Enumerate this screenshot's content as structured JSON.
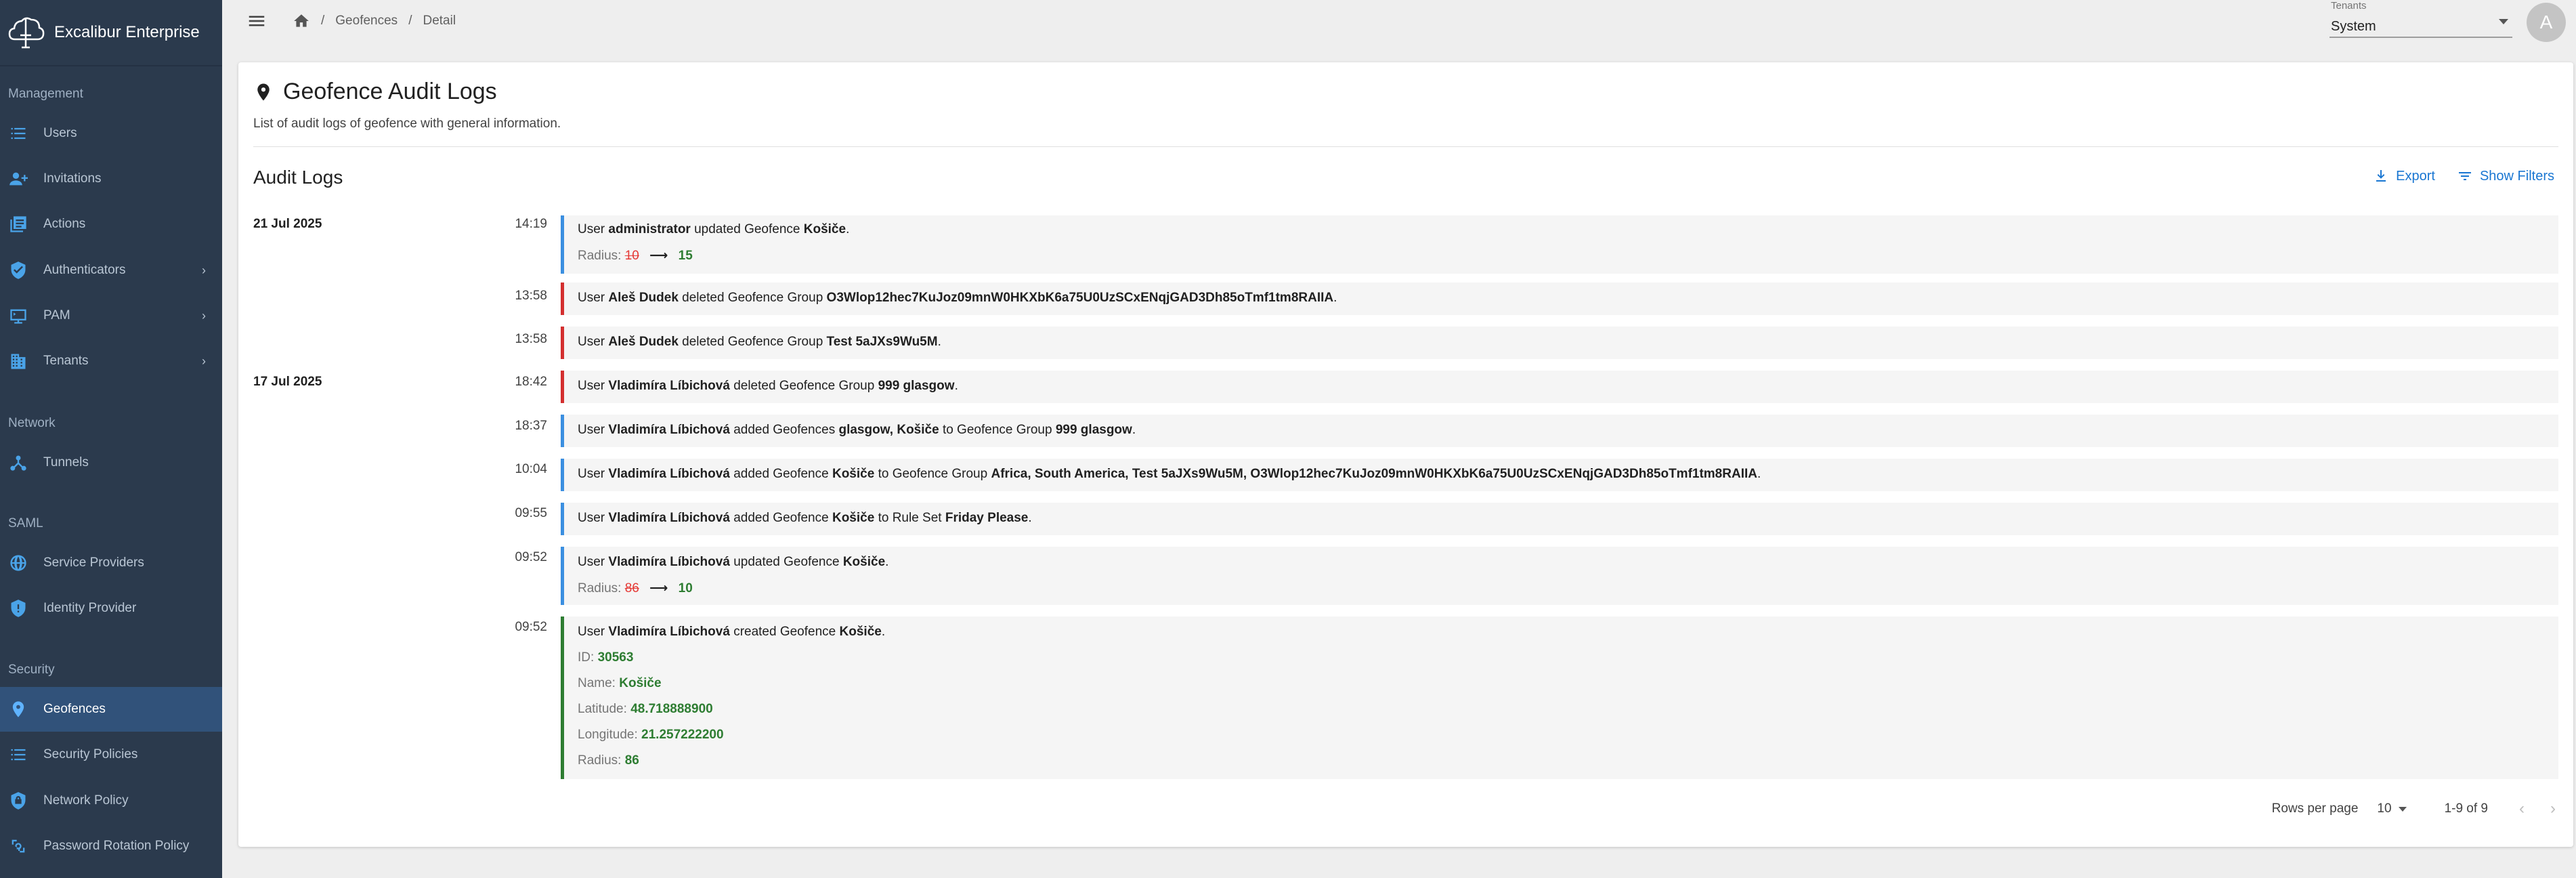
{
  "app": {
    "title": "Excalibur Enterprise"
  },
  "sidebar": {
    "sections": [
      {
        "label": "Management"
      },
      {
        "label": "Network"
      },
      {
        "label": "SAML"
      },
      {
        "label": "Security"
      }
    ],
    "items": [
      {
        "label": "Users",
        "icon": "list-icon"
      },
      {
        "label": "Invitations",
        "icon": "person-add-icon"
      },
      {
        "label": "Actions",
        "icon": "library-icon"
      },
      {
        "label": "Authenticators",
        "icon": "shield-check-icon"
      },
      {
        "label": "PAM",
        "icon": "terminal-icon"
      },
      {
        "label": "Tenants",
        "icon": "building-icon"
      },
      {
        "label": "Tunnels",
        "icon": "tunnel-icon"
      },
      {
        "label": "Service Providers",
        "icon": "globe-icon"
      },
      {
        "label": "Identity Provider",
        "icon": "shield-icon"
      },
      {
        "label": "Geofences",
        "icon": "location-pin-icon"
      },
      {
        "label": "Security Policies",
        "icon": "list-icon"
      },
      {
        "label": "Network Policy",
        "icon": "shield-lock-icon"
      },
      {
        "label": "Password Rotation Policy",
        "icon": "rotate-key-icon"
      }
    ]
  },
  "breadcrumb": {
    "items": [
      "Geofences",
      "Detail"
    ],
    "separator": "/"
  },
  "tenants": {
    "label": "Tenants",
    "value": "System"
  },
  "user": {
    "avatar_initial": "A"
  },
  "page": {
    "title": "Geofence Audit Logs",
    "subtitle": "List of audit logs of geofence with general information.",
    "section_title": "Audit Logs",
    "export_label": "Export",
    "filters_label": "Show Filters"
  },
  "logs": {
    "dates": [
      "21 Jul 2025",
      "17 Jul 2025"
    ],
    "entries": [
      {
        "time": "14:19",
        "user": "administrator",
        "verb": "updated Geofence",
        "target": "Košiče",
        "field": "Radius:",
        "old": "10",
        "new": "15"
      },
      {
        "time": "13:58",
        "user": "Aleš Dudek",
        "verb": "deleted Geofence Group",
        "target": "O3Wlop12hec7KuJoz09mnW0HKXbK6a75U0UzSCxENqjGAD3Dh85oTmf1tm8RAIIA"
      },
      {
        "time": "13:58",
        "user": "Aleš Dudek",
        "verb": "deleted Geofence Group",
        "target": "Test 5aJXs9Wu5M"
      },
      {
        "time": "18:42",
        "user": "Vladimíra Líbichová",
        "verb": "deleted Geofence Group",
        "target": "999 glasgow"
      },
      {
        "time": "18:37",
        "user": "Vladimíra Líbichová",
        "verb": "added Geofences",
        "target": "glasgow, Košiče",
        "verb2": "to Geofence Group",
        "target2": "999 glasgow"
      },
      {
        "time": "10:04",
        "user": "Vladimíra Líbichová",
        "verb": "added Geofence",
        "target": "Košiče",
        "verb2": "to Geofence Group",
        "target2": "Africa, South America, Test 5aJXs9Wu5M, O3Wlop12hec7KuJoz09mnW0HKXbK6a75U0UzSCxENqjGAD3Dh85oTmf1tm8RAIIA"
      },
      {
        "time": "09:55",
        "user": "Vladimíra Líbichová",
        "verb": "added Geofence",
        "target": "Košiče",
        "verb2": "to Rule Set",
        "target2": "Friday Please"
      },
      {
        "time": "09:52",
        "user": "Vladimíra Líbichová",
        "verb": "updated Geofence",
        "target": "Košiče",
        "field": "Radius:",
        "old": "86",
        "new": "10"
      },
      {
        "time": "09:52",
        "user": "Vladimíra Líbichová",
        "verb": "created Geofence",
        "target": "Košiče",
        "fields": [
          {
            "label": "ID:",
            "value": "30563"
          },
          {
            "label": "Name:",
            "value": "Košiče"
          },
          {
            "label": "Latitude:",
            "value": "48.718888900"
          },
          {
            "label": "Longitude:",
            "value": "21.257222200"
          },
          {
            "label": "Radius:",
            "value": "86"
          }
        ]
      }
    ],
    "user_prefix": "User",
    "arrow": "⟶"
  },
  "pagination": {
    "rows_per_page_label": "Rows per page",
    "rows_per_page_value": "10",
    "range": "1-9 of 9",
    "prev": "‹",
    "next": "›"
  },
  "colors": {
    "sidebar_bg": "#2b3a4d",
    "accent": "#1976d2",
    "delete": "#d32f2f",
    "create": "#2e7d32",
    "update": "#3b8fe0"
  }
}
